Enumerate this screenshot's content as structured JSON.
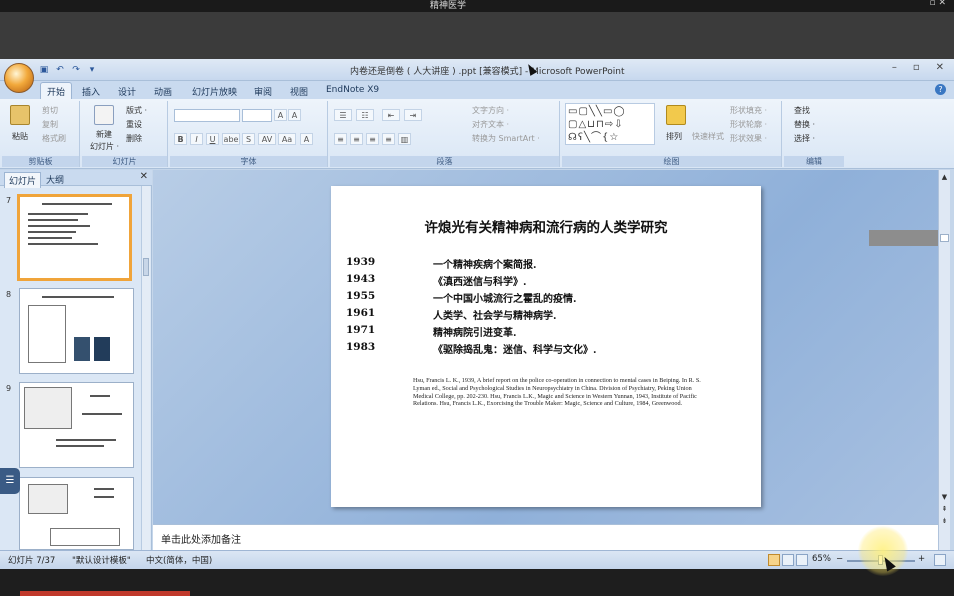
{
  "top": {
    "title": "精神医学"
  },
  "window": {
    "title": "内卷还是倒卷 ( 人大讲座 ) .ppt [兼容模式] - Microsoft PowerPoint",
    "minimize": "–",
    "restore": "▫",
    "close": "✕"
  },
  "tabs": [
    "开始",
    "插入",
    "设计",
    "动画",
    "幻灯片放映",
    "审阅",
    "视图",
    "EndNote X9"
  ],
  "ribbon": {
    "clipboard": {
      "label": "剪贴板",
      "paste": "粘贴",
      "cut": "剪切",
      "copy": "复制",
      "format_painter": "格式刷"
    },
    "slides": {
      "label": "幻灯片",
      "new_slide": "新建",
      "new_slide2": "幻灯片 ·",
      "layout": "版式 ·",
      "reset": "重设",
      "delete": "删除"
    },
    "font": {
      "label": "字体",
      "grow": "A",
      "shrink": "A",
      "bold": "B",
      "italic": "I",
      "underline": "U",
      "strike": "abe",
      "shadow": "S",
      "spacing": "AV",
      "case": "Aa",
      "color": "A"
    },
    "paragraph": {
      "label": "段落",
      "text_dir": "文字方向 ·",
      "align_text": "对齐文本 ·",
      "smartart": "转换为 SmartArt ·"
    },
    "drawing": {
      "label": "绘图",
      "arrange": "排列",
      "quick_styles": "快速样式",
      "fill": "形状填充 ·",
      "outline": "形状轮廓 ·",
      "effects": "形状效果 ·",
      "shapes_row1": "▭▢╲╲▭◯",
      "shapes_row2": "▢△⊔⊓⇨⇩",
      "shapes_row3": "☊ʕ╲⌒{☆"
    },
    "editing": {
      "label": "编辑",
      "find": "查找",
      "replace": "替换 ·",
      "select": "选择 ·"
    }
  },
  "panel": {
    "tab_slides": "幻灯片",
    "tab_outline": "大纲",
    "close": "✕",
    "slide_numbers": [
      "7",
      "8",
      "9"
    ]
  },
  "slide": {
    "title": "许烺光有关精神病和流行病的人类学研究",
    "works": [
      {
        "year": "1939",
        "title": "一个精神疾病个案简报."
      },
      {
        "year": "1943",
        "title": "《滇西迷信与科学》."
      },
      {
        "year": "1955",
        "title": "一个中国小城流行之霍乱的疫情."
      },
      {
        "year": "1961",
        "title": "人类学、社会学与精神病学."
      },
      {
        "year": "1971",
        "title": "精神病院引进变革."
      },
      {
        "year": "1983",
        "title": "《驱除捣乱鬼：迷信、科学与文化》."
      }
    ],
    "references": "Hsu, Francis L. K., 1939, A brief report on the police co-operation in connection to mental cases in Beiping. In R. S. Lyman ed., Social and Psychological Studies in Neuropsychiatry in China. Division of Psychiatry, Peking Union Medical College, pp. 202-230. Hsu, Francis L.K., Magic and Science in Western Yunnan, 1943, Institute of Pacific Relations. Hsu, Francis L.K., Exorcising the Trouble Maker: Magic, Science and Culture, 1984, Greenwood."
  },
  "notes": {
    "placeholder": "单击此处添加备注"
  },
  "status": {
    "slide_pos": "幻灯片 7/37",
    "theme": "\"默认设计模板\"",
    "language": "中文(简体，中国)",
    "zoom": "65%",
    "zoom_minus": "−",
    "zoom_plus": "+"
  }
}
